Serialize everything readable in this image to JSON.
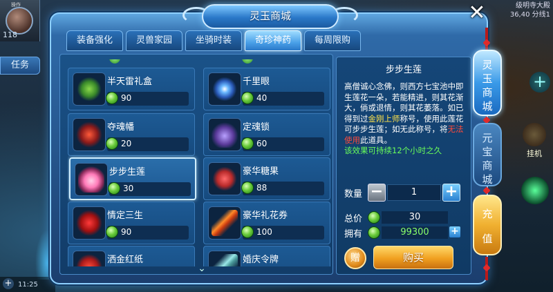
{
  "hud": {
    "top_left_tiny": "操作",
    "level": "118",
    "task_label": "任务",
    "top_right_line1": "级明寺大殿",
    "top_right_line2": "36,40 分线1",
    "time": "11:25",
    "guaji_label": "挂机"
  },
  "dialog": {
    "title": "灵玉商城",
    "close_label": "✕",
    "scroll_more": "⌄"
  },
  "tabs": [
    {
      "label": "装备强化",
      "active": false
    },
    {
      "label": "灵兽家园",
      "active": false
    },
    {
      "label": "坐骑时装",
      "active": false
    },
    {
      "label": "奇珍神药",
      "active": true
    },
    {
      "label": "每周限购",
      "active": false
    }
  ],
  "items": [
    {
      "name": "半天雷礼盒",
      "price": "90",
      "icon": "leaf-gift-icon"
    },
    {
      "name": "千里眼",
      "price": "40",
      "icon": "eye-orb-icon"
    },
    {
      "name": "夺魂幡",
      "price": "20",
      "icon": "banner-icon"
    },
    {
      "name": "定魂锁",
      "price": "60",
      "icon": "lock-icon"
    },
    {
      "name": "步步生莲",
      "price": "30",
      "icon": "lotus-icon",
      "selected": true
    },
    {
      "name": "豪华糖果",
      "price": "88",
      "icon": "candy-icon"
    },
    {
      "name": "情定三生",
      "price": "90",
      "icon": "love-knot-icon"
    },
    {
      "name": "豪华礼花券",
      "price": "100",
      "icon": "firework-icon"
    },
    {
      "name": "洒金红纸",
      "price": "",
      "icon": "red-paper-icon"
    },
    {
      "name": "婚庆令牌",
      "price": "",
      "icon": "tablet-icon"
    }
  ],
  "detail": {
    "title": "步步生莲",
    "desc_part1": "高僧诚心念佛，则西方七宝池中即生莲花一朵，若能精进，则其花渐大，倘或退情，则其花萎落。如已得到过",
    "desc_hl1": "金刚上师",
    "desc_part2": "称号，使用此莲花可步步生莲；如无此称号，将",
    "desc_hl2": "无法使用",
    "desc_part3": "此道具。",
    "desc_effect": "该效果可持续12个小时之久",
    "qty_label": "数量",
    "qty_minus": "−",
    "qty_value": "1",
    "qty_plus": "+",
    "total_label": "总价",
    "total_value": "30",
    "own_label": "拥有",
    "own_value": "99300",
    "own_plus": "+",
    "gift_label": "赠",
    "buy_label": "购买"
  },
  "side_nav": {
    "lingyu": [
      "灵",
      "玉",
      "商",
      "城"
    ],
    "yuanbao": [
      "元",
      "宝",
      "商",
      "城"
    ],
    "chongzhi": [
      "充",
      "值"
    ]
  },
  "colors": {
    "frame": "#2f6aa8",
    "accent": "#8ed0ff",
    "highlight_yellow": "#ffe24a",
    "highlight_red": "#ff4a3a",
    "effect_green": "#6aff5a",
    "buy_button": "#f0a020"
  }
}
